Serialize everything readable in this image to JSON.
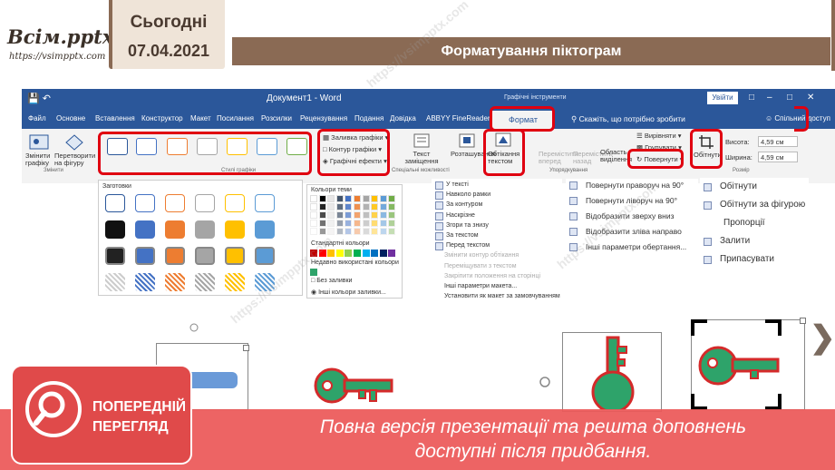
{
  "header": {
    "logo": "Всім.pptx",
    "logo_url": "https://vsimpptx.com",
    "day_label": "Сьогодні",
    "date": "07.04.2021",
    "slide_title": "Форматування піктограм"
  },
  "word": {
    "doc_title": "Документ1 - Word",
    "context_title": "Графічні інструменти",
    "login": "Увійти",
    "tabs": [
      "Файл",
      "Основне",
      "Вставлення",
      "Конструктор",
      "Макет",
      "Посилання",
      "Розсилки",
      "Рецензування",
      "Подання",
      "Довідка",
      "ABBYY FineReader 1"
    ],
    "active_tab": "Формат",
    "tell_me": "Скажіть, що потрібно зробити",
    "share": "Спільний доступ",
    "ribbon": {
      "change_graphic": "Змінити графіку",
      "convert_shape": "Перетворити на фігуру",
      "group_change": "Змінити",
      "group_styles": "Стилі графіки",
      "fill": "Заливка графіки",
      "outline": "Контур графіки",
      "effects": "Графічні ефекти",
      "alt_text": "Текст заміщення",
      "group_access": "Спеціальні можливості",
      "position": "Розташування",
      "wrap": "Обтікання текстом",
      "forward": "Перемістити вперед",
      "backward": "Перемістити назад",
      "selection": "Область виділення",
      "align": "Вирівняти",
      "group_obj": "Групувати",
      "rotate": "Повернути",
      "group_arrange": "Упорядкування",
      "crop": "Обітнути",
      "height_label": "Висота:",
      "height_value": "4,59 см",
      "width_label": "Ширина:",
      "width_value": "4,59 см",
      "group_size": "Розмір"
    }
  },
  "styles_panel": {
    "header": "Заготовки"
  },
  "fill_panel": {
    "theme_colors": "Кольори теми",
    "standard_colors": "Стандартні кольори",
    "recent_colors": "Недавно використані кольори",
    "no_fill": "Без заливки",
    "more_colors": "Інші кольори заливки..."
  },
  "wrap_panel": {
    "items": [
      "У тексті",
      "Навколо рамки",
      "За контуром",
      "Наскрізне",
      "Згори та знизу",
      "За текстом",
      "Перед текстом",
      "Змінити контур обтікання",
      "Переміщувати з текстом",
      "Закріпити положення на сторінці",
      "Інші параметри макета...",
      "Установити як макет за замовчуванням"
    ]
  },
  "rotate_panel": {
    "items": [
      "Повернути праворуч на 90°",
      "Повернути ліворуч на 90°",
      "Відобразити зверху вниз",
      "Відобразити зліва направо",
      "Інші параметри обертання..."
    ]
  },
  "crop_panel": {
    "items": [
      "Обітнути",
      "Обітнути за фігурою",
      "Пропорції",
      "Залити",
      "Припасувати"
    ]
  },
  "banner": {
    "preview_line1": "ПОПЕРЕДНІЙ",
    "preview_line2": "ПЕРЕГЛЯД",
    "text_line1": "Повна версія презентації та решта доповнень",
    "text_line2": "доступні після придбання."
  },
  "colors": {
    "brand_brown": "#8a6a54",
    "word_blue": "#2b579a",
    "highlight_red": "#e00010",
    "key_green": "#2ea36a",
    "key_outline": "#d42a2a",
    "banner_red": "#ec5858"
  },
  "icons": [
    "search-icon",
    "key-icon",
    "rotate-icon",
    "crop-icon",
    "wrap-icon"
  ]
}
